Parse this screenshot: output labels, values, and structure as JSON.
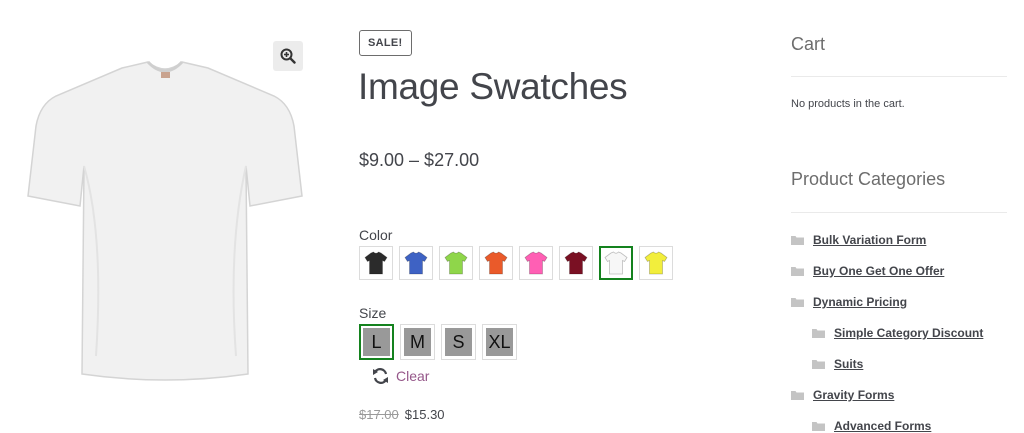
{
  "product": {
    "sale_badge": "SALE!",
    "title": "Image Swatches",
    "price_range": "$9.00 – $27.00",
    "color_label": "Color",
    "color_swatches": [
      {
        "name": "black",
        "color": "#2b2b2b"
      },
      {
        "name": "blue",
        "color": "#3e62c4"
      },
      {
        "name": "lime",
        "color": "#8fd64a"
      },
      {
        "name": "orange",
        "color": "#ea5a2a"
      },
      {
        "name": "pink",
        "color": "#ff5fb4"
      },
      {
        "name": "maroon",
        "color": "#7a1023"
      },
      {
        "name": "white",
        "color": "#f7f7f7",
        "selected": true
      },
      {
        "name": "yellow",
        "color": "#f2ee3c"
      }
    ],
    "size_label": "Size",
    "sizes": [
      {
        "label": "L",
        "selected": true
      },
      {
        "label": "M"
      },
      {
        "label": "S"
      },
      {
        "label": "XL"
      }
    ],
    "clear_label": "Clear",
    "regular_price": "$17.00",
    "sale_price": "$15.30"
  },
  "sidebar": {
    "cart_title": "Cart",
    "cart_empty": "No products in the cart.",
    "categories_title": "Product Categories",
    "categories": [
      {
        "label": "Bulk Variation Form",
        "level": 0
      },
      {
        "label": "Buy One Get One Offer",
        "level": 0
      },
      {
        "label": "Dynamic Pricing",
        "level": 0
      },
      {
        "label": "Simple Category Discount",
        "level": 1
      },
      {
        "label": "Suits",
        "level": 1
      },
      {
        "label": "Gravity Forms",
        "level": 0
      },
      {
        "label": "Advanced Forms",
        "level": 1
      }
    ]
  },
  "icons": {
    "zoom": "zoom-in-icon",
    "clear": "refresh-icon",
    "category": "folder-icon"
  },
  "colors": {
    "accent": "#96588a",
    "selected_border": "#14821e",
    "text": "#43454b"
  }
}
